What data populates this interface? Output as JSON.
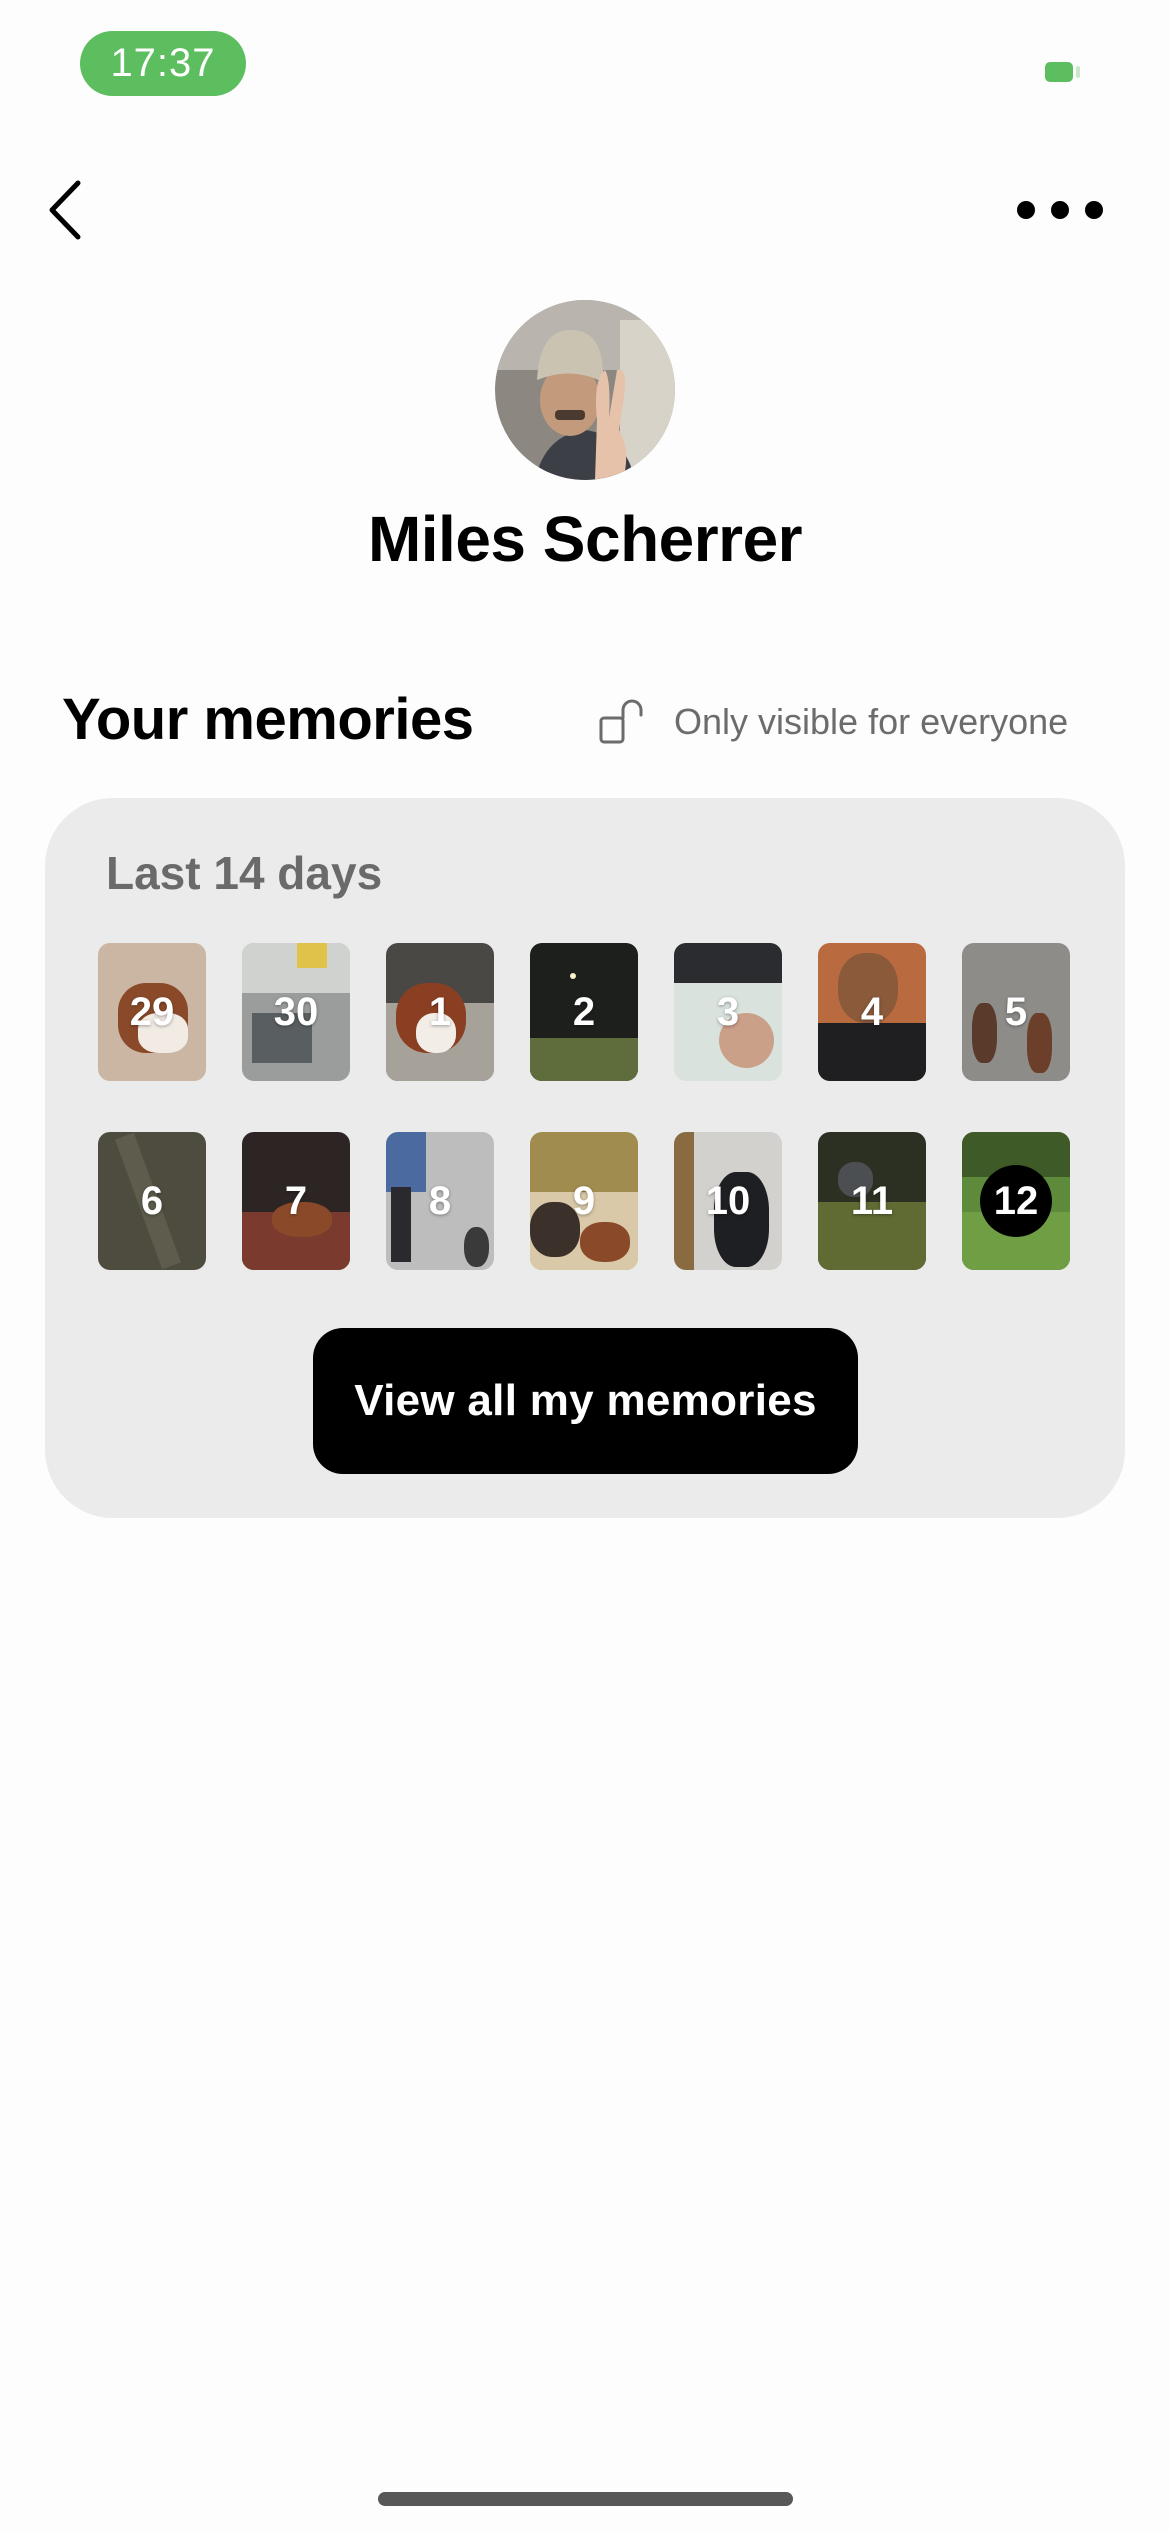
{
  "status_bar": {
    "time": "17:37",
    "colors": {
      "call_pill": "#5cbe5e",
      "battery": "#5cbe5e"
    }
  },
  "nav": {
    "back_icon": "chevron-left-icon",
    "more_icon": "more-horizontal-icon"
  },
  "profile": {
    "name": "Miles Scherrer",
    "avatar": "profile-photo"
  },
  "memories": {
    "title": "Your memories",
    "visibility_icon": "unlocked-padlock-icon",
    "visibility_text": "Only visible for everyone",
    "card_title": "Last 14 days",
    "days": [
      {
        "label": "29",
        "today": false
      },
      {
        "label": "30",
        "today": false
      },
      {
        "label": "1",
        "today": false
      },
      {
        "label": "2",
        "today": false
      },
      {
        "label": "3",
        "today": false
      },
      {
        "label": "4",
        "today": false
      },
      {
        "label": "5",
        "today": false
      },
      {
        "label": "6",
        "today": false
      },
      {
        "label": "7",
        "today": false
      },
      {
        "label": "8",
        "today": false
      },
      {
        "label": "9",
        "today": false
      },
      {
        "label": "10",
        "today": false
      },
      {
        "label": "11",
        "today": false
      },
      {
        "label": "12",
        "today": true
      }
    ],
    "cta_label": "View all my memories"
  }
}
